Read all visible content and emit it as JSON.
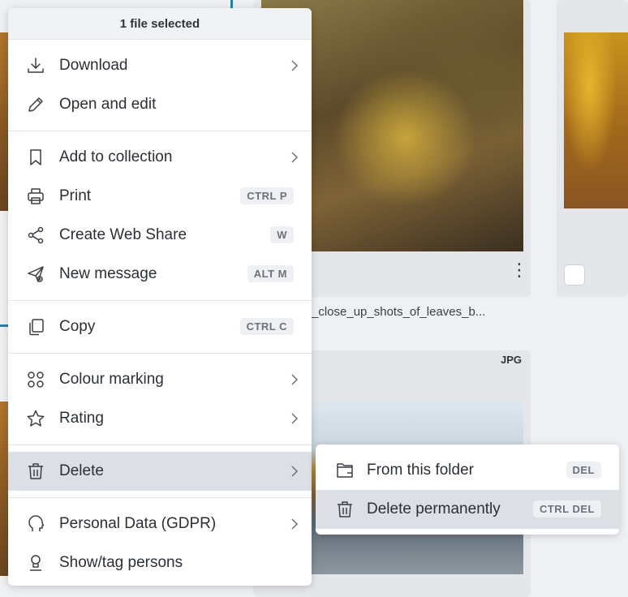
{
  "menu": {
    "header": "1 file selected",
    "items": {
      "download": {
        "label": "Download",
        "icon": "download-icon"
      },
      "open_edit": {
        "label": "Open and edit",
        "icon": "pencil-icon"
      },
      "add_collection": {
        "label": "Add to collection",
        "icon": "bookmark-icon"
      },
      "print": {
        "label": "Print",
        "icon": "printer-icon",
        "shortcut": "CTRL P"
      },
      "web_share": {
        "label": "Create Web Share",
        "icon": "share-icon",
        "shortcut": "W"
      },
      "new_message": {
        "label": "New message",
        "icon": "send-icon",
        "shortcut": "ALT M"
      },
      "copy": {
        "label": "Copy",
        "icon": "copy-icon",
        "shortcut": "CTRL C"
      },
      "colour_marking": {
        "label": "Colour marking",
        "icon": "colour-dots-icon"
      },
      "rating": {
        "label": "Rating",
        "icon": "star-icon"
      },
      "delete": {
        "label": "Delete",
        "icon": "trash-icon"
      },
      "gdpr": {
        "label": "Personal Data (GDPR)",
        "icon": "head-icon"
      },
      "tag_persons": {
        "label": "Show/tag persons",
        "icon": "person-tag-icon"
      }
    }
  },
  "submenu": {
    "from_folder": {
      "label": "From this folder",
      "icon": "folder-remove-icon",
      "shortcut": "DEL"
    },
    "delete_perm": {
      "label": "Delete permanently",
      "icon": "trash-icon",
      "shortcut": "CTRL DEL"
    }
  },
  "background": {
    "filename": "_close_up_shots_of_leaves_b...",
    "type_badge": "JPG"
  },
  "colors": {
    "accent": "#2a7fa8",
    "active_row": "#dcdfe4",
    "kbd_bg": "#eef0f3"
  }
}
